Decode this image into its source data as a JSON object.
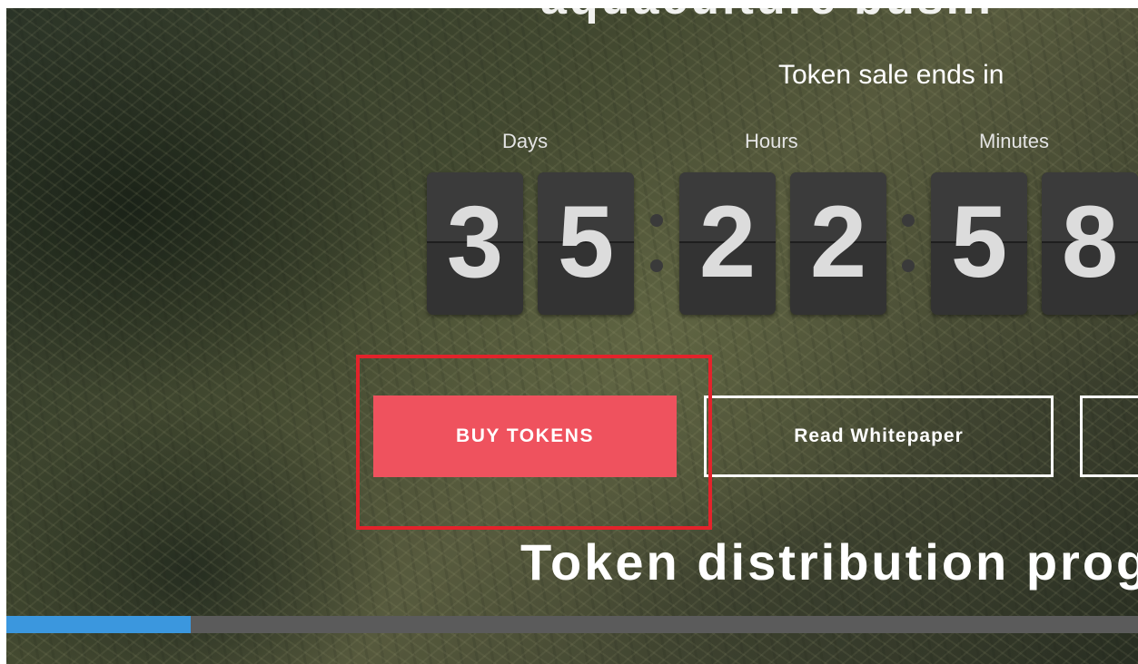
{
  "hero": {
    "heading": "aquaculture busin",
    "sale_label": "Token sale ends in"
  },
  "countdown": {
    "units": [
      {
        "label": "Days",
        "digits": [
          "3",
          "5"
        ]
      },
      {
        "label": "Hours",
        "digits": [
          "2",
          "2"
        ]
      },
      {
        "label": "Minutes",
        "digits": [
          "5",
          "8"
        ]
      }
    ]
  },
  "actions": {
    "buy_label": "BUY TOKENS",
    "whitepaper_label": "Read Whitepaper",
    "third_label": ""
  },
  "distribution": {
    "heading": "Token distribution prog",
    "progress_fraction": 0.163
  },
  "colors": {
    "buy_button": "#ef525e",
    "highlight_border": "#e3232b",
    "progress_fill": "#3b97de",
    "progress_track": "#5b5b5b",
    "digit_card": "#333333"
  }
}
